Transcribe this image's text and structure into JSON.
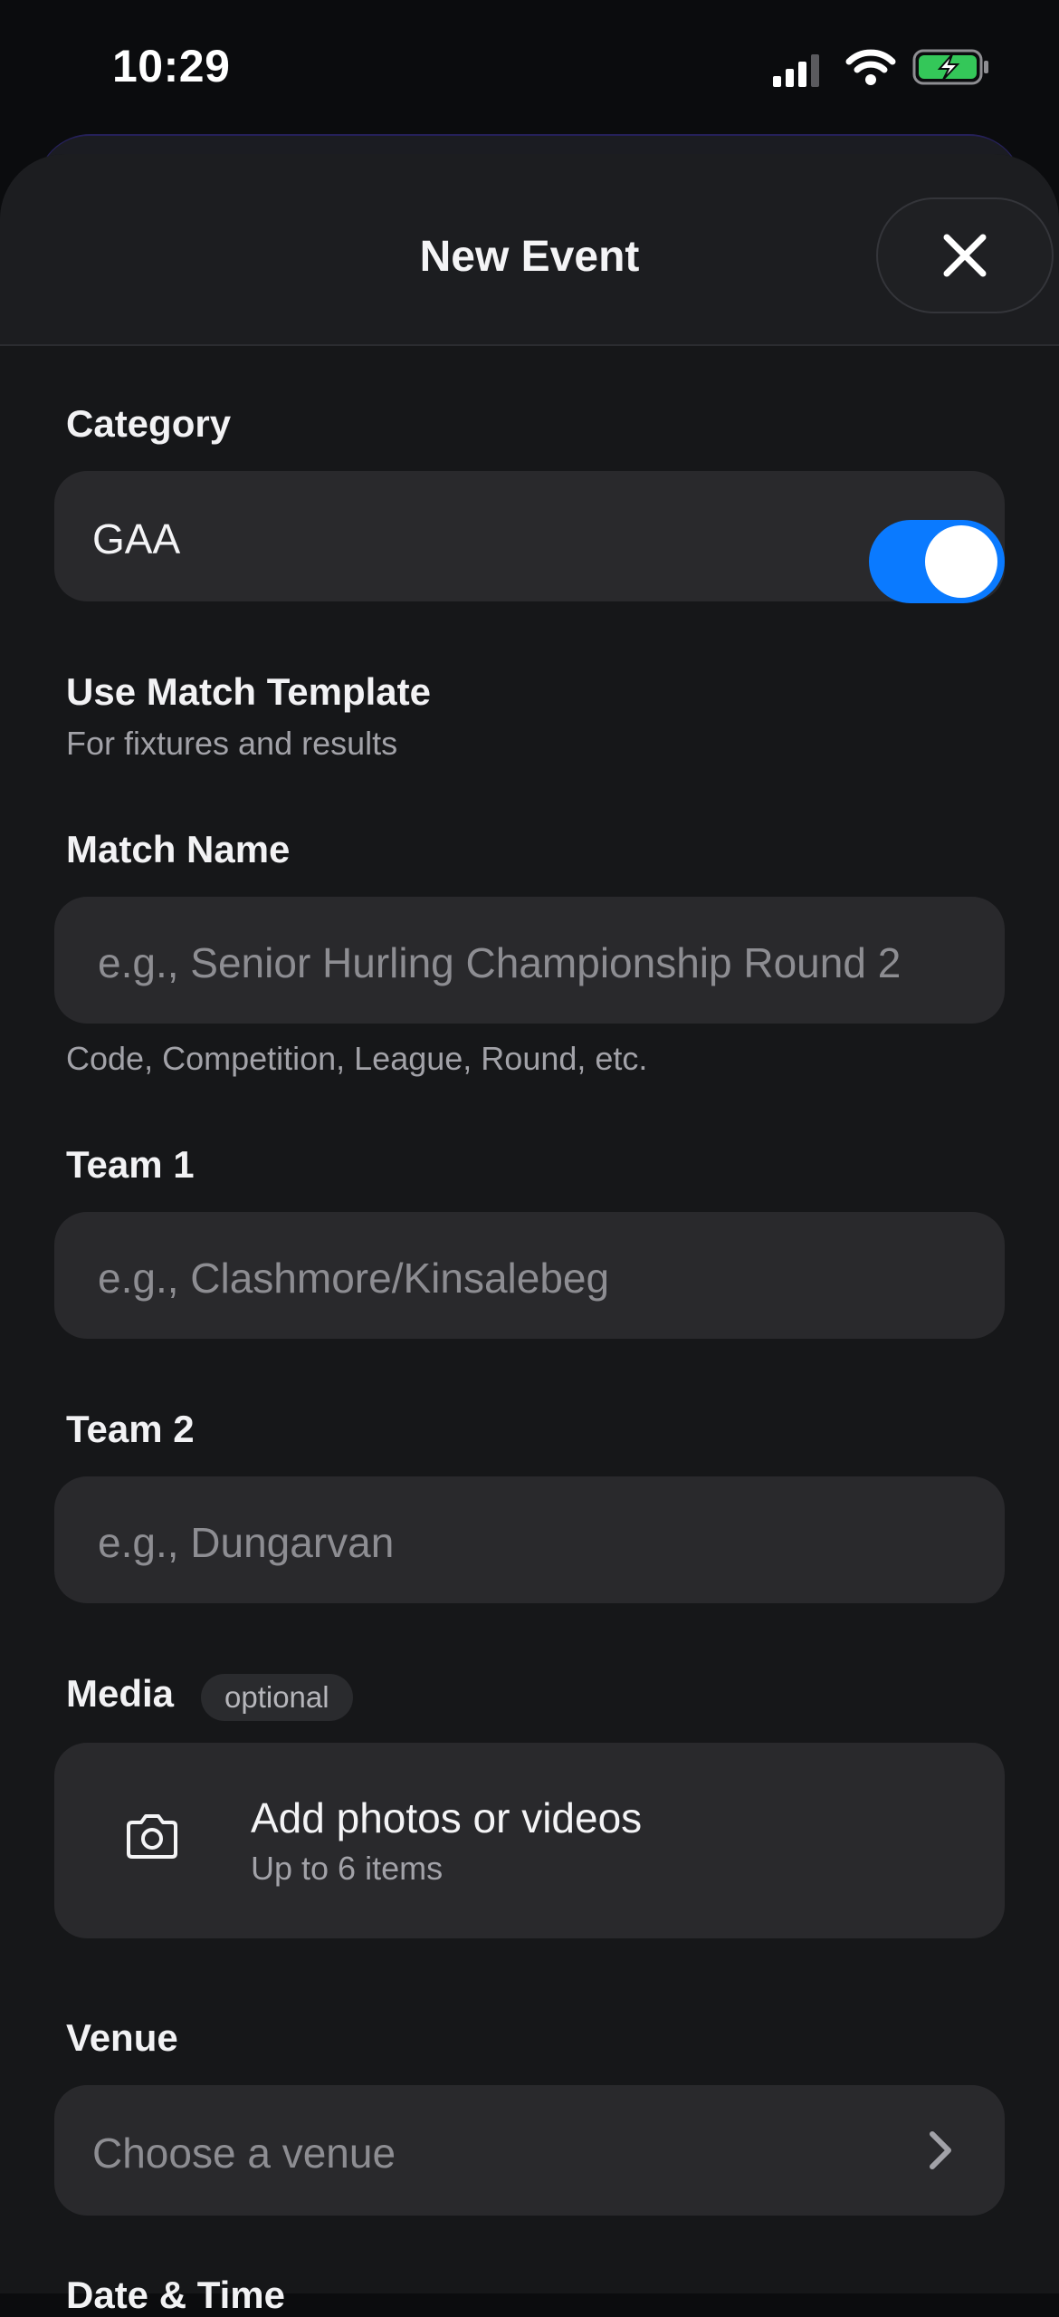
{
  "status_bar": {
    "time": "10:29"
  },
  "sheet": {
    "title": "New Event",
    "close_icon": "close-icon"
  },
  "category": {
    "label": "Category",
    "value": "GAA"
  },
  "template": {
    "label": "Use Match Template",
    "subtitle": "For fixtures and results",
    "enabled": true,
    "accent": "#0a7aff"
  },
  "match_name": {
    "label": "Match Name",
    "placeholder": "e.g., Senior Hurling Championship Round 2",
    "hint": "Code, Competition, League, Round, etc."
  },
  "team1": {
    "label": "Team 1",
    "placeholder": "e.g., Clashmore/Kinsalebeg"
  },
  "team2": {
    "label": "Team 2",
    "placeholder": "e.g., Dungarvan"
  },
  "media": {
    "label": "Media",
    "badge": "optional",
    "title": "Add photos or videos",
    "subtitle": "Up to 6 items"
  },
  "venue": {
    "label": "Venue",
    "placeholder": "Choose a venue"
  },
  "next_section": {
    "label": "Date & Time"
  }
}
